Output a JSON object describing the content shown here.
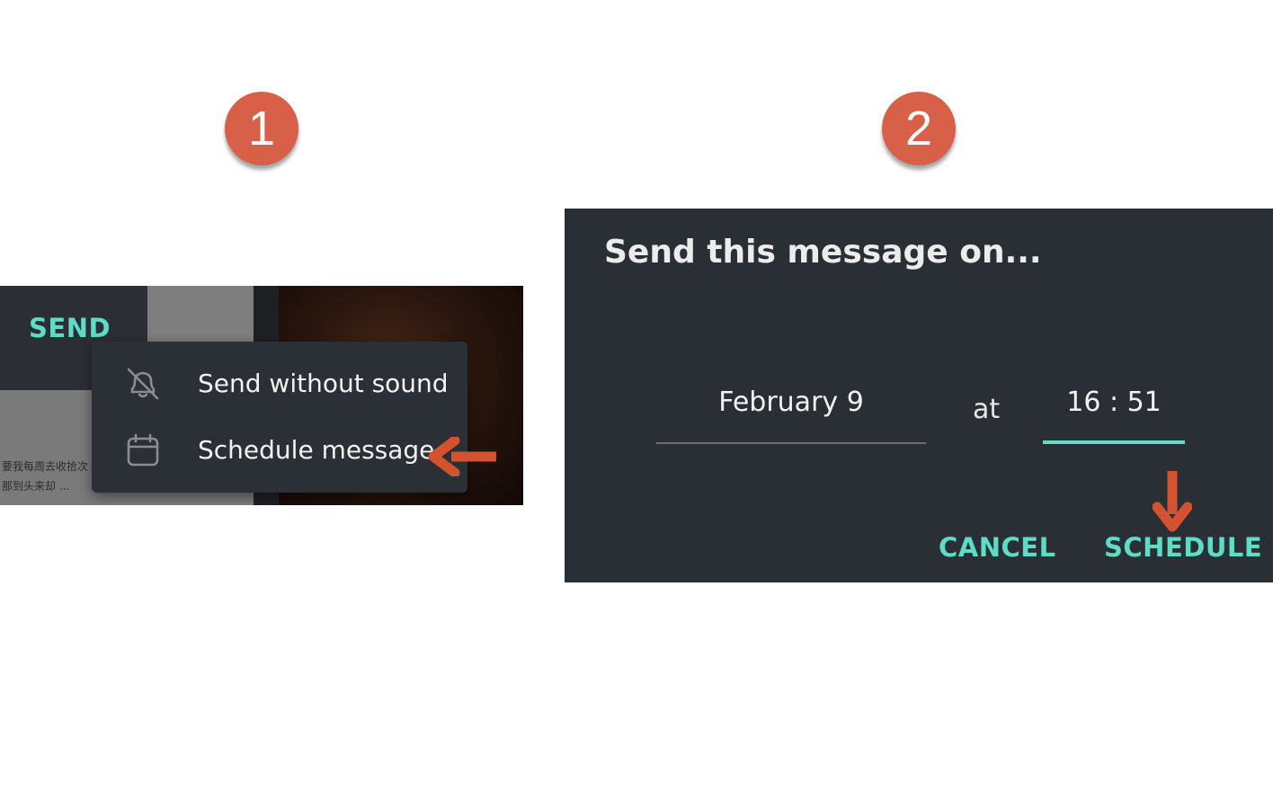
{
  "badges": {
    "step1": "1",
    "step2": "2"
  },
  "panel1": {
    "send_label": "SEND",
    "chat_preview": [
      "要我每周去收拾次",
      "那到头来却 ..."
    ],
    "menu": [
      {
        "icon": "muted-bell-icon",
        "label": "Send without sound"
      },
      {
        "icon": "calendar-icon",
        "label": "Schedule message"
      }
    ]
  },
  "panel2": {
    "title": "Send this message on...",
    "date_value": "February 9",
    "at_label": "at",
    "time_value": "16 : 51",
    "cancel_label": "CANCEL",
    "schedule_label": "SCHEDULE"
  },
  "colors": {
    "badge": "#d85f48",
    "accent": "#5ddcc6",
    "menu_bg": "#2b2f36",
    "dialog_bg": "#2a2e35",
    "arrow": "#d3522f"
  }
}
